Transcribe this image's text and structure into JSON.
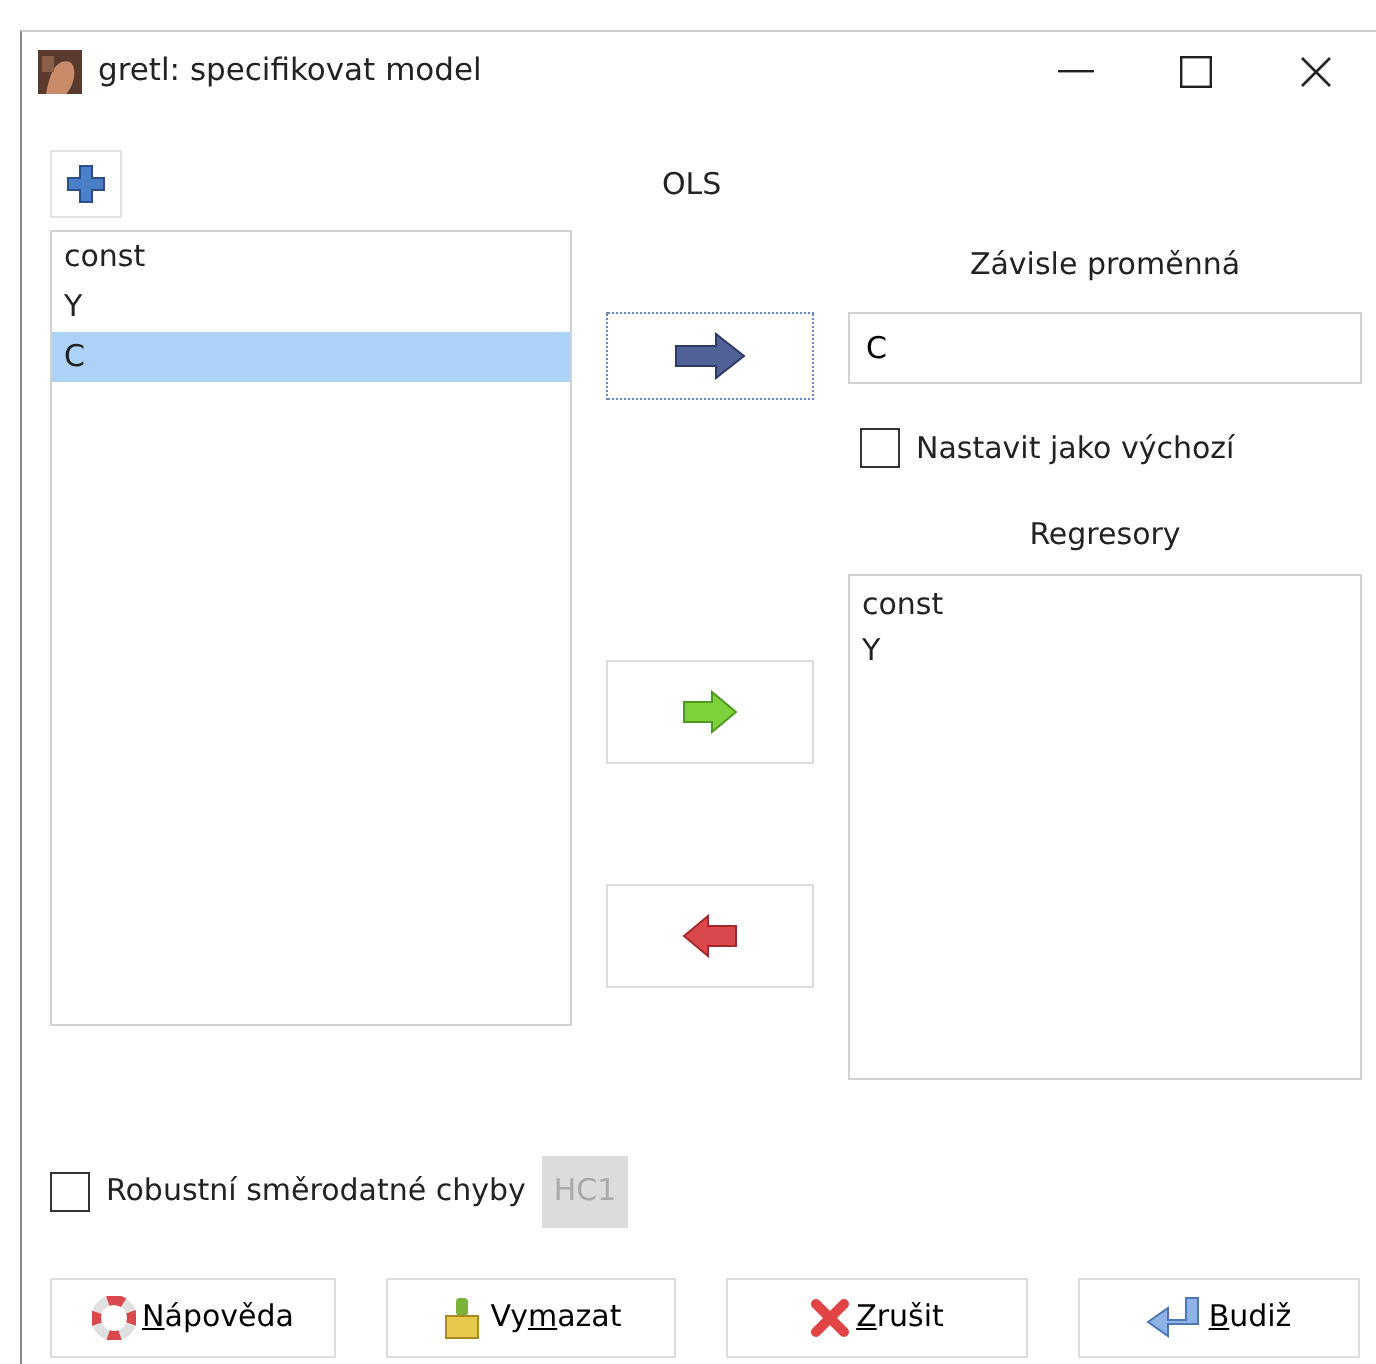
{
  "window": {
    "title": "gretl: specifikovat model"
  },
  "estimator": "OLS",
  "variables": [
    {
      "name": "const",
      "selected": false
    },
    {
      "name": "Y",
      "selected": false
    },
    {
      "name": "C",
      "selected": true
    }
  ],
  "dependent": {
    "label": "Závisle proměnná",
    "value": "C",
    "default_label": "Nastavit jako výchozí",
    "default_checked": false
  },
  "regressors": {
    "label": "Regresory",
    "items": [
      "const",
      "Y"
    ]
  },
  "robust": {
    "label": "Robustní směrodatné chyby",
    "checked": false,
    "hc_button": "HC1",
    "hc_disabled": true
  },
  "buttons": [
    {
      "kind": "help",
      "key": "N",
      "post": "ápověda"
    },
    {
      "kind": "clear",
      "pre": "Vy",
      "key": "m",
      "post": "azat"
    },
    {
      "kind": "cancel",
      "key": "Z",
      "post": "rušit"
    },
    {
      "kind": "ok",
      "key": "B",
      "post": "udiž"
    }
  ]
}
